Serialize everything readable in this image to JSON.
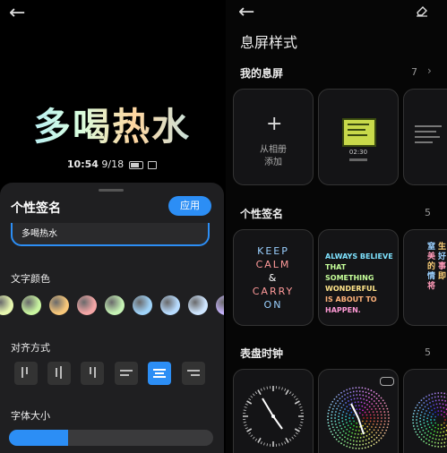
{
  "left": {
    "hero_text": "多喝热水",
    "clock": {
      "time": "10:54",
      "date": "9/18"
    },
    "sheet": {
      "title": "个性签名",
      "apply_label": "应用",
      "input_value": "多喝热水",
      "color_label": "文字颜色",
      "align_label": "对齐方式",
      "size_label": "字体大小",
      "font_size_fraction": 0.29
    },
    "swatches": [
      "#e7f7b0",
      "#c9f5a0",
      "#f7c77a",
      "#f4a6a6",
      "#c6f3b5",
      "#9fd3f9",
      "#b8dcff",
      "#cfe6ff",
      "#c8b5ff"
    ]
  },
  "right": {
    "title": "息屏样式",
    "my_screen": {
      "label": "我的息屏",
      "count": "7"
    },
    "add_card": {
      "line1": "从相册",
      "line2": "添加"
    },
    "widget_time": "02:30",
    "signature": {
      "label": "个性签名",
      "count": "5",
      "keep_calm": [
        "KEEP",
        "CALM",
        "&",
        "CARRY",
        "ON"
      ],
      "always": [
        "ALWAYS BELIEVE",
        "THAT SOMETHING",
        "WONDERFUL",
        "IS ABOUT TO",
        "HAPPEN."
      ],
      "partial_chars": [
        "窒",
        "生",
        "美",
        "好",
        "的",
        "事",
        "情",
        "即",
        "将"
      ]
    },
    "clock_face": {
      "label": "表盘时钟",
      "count": "5"
    }
  }
}
